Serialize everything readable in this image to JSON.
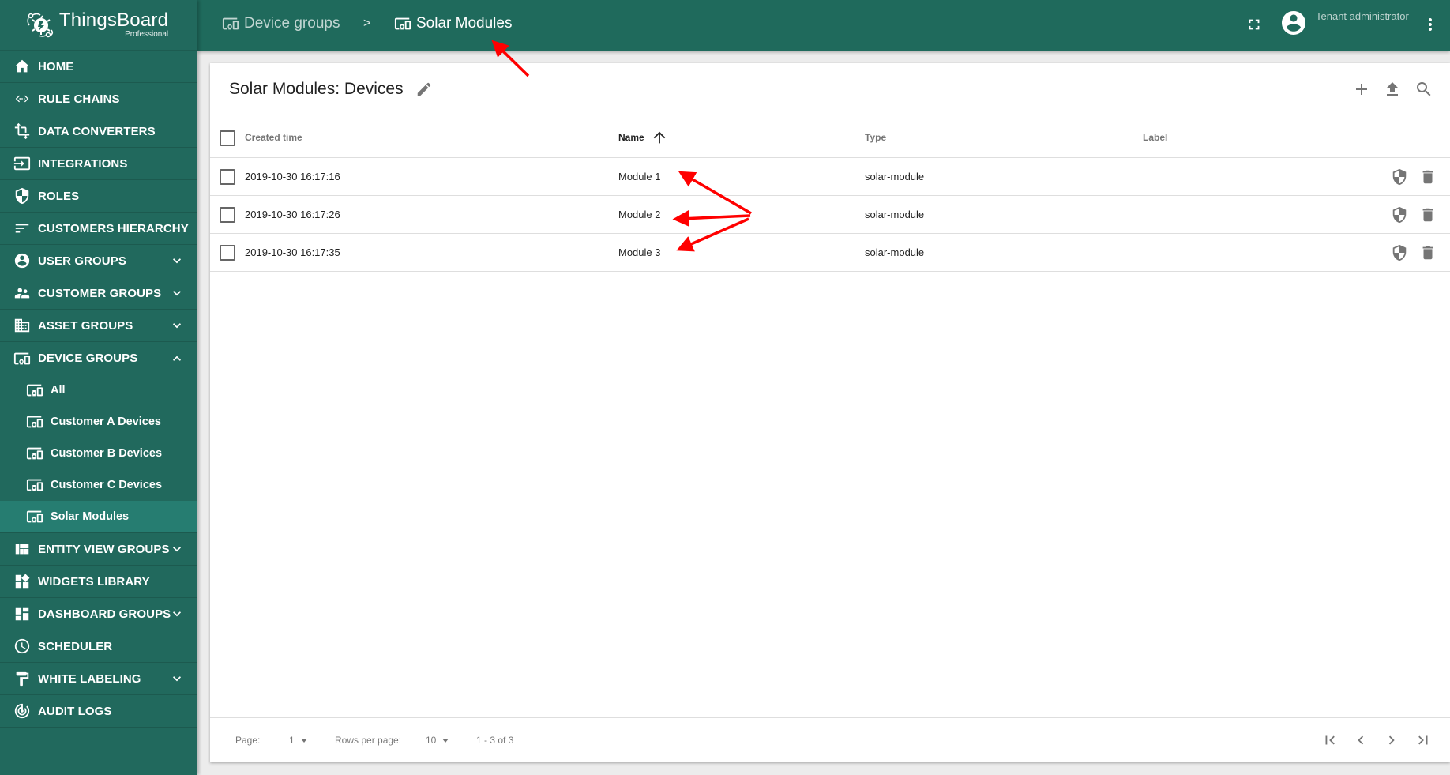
{
  "app": {
    "brand": "ThingsBoard",
    "edition": "Professional"
  },
  "sidebar": {
    "items": [
      {
        "label": "HOME",
        "icon": "home-icon"
      },
      {
        "label": "RULE CHAINS",
        "icon": "rule-chains-icon"
      },
      {
        "label": "DATA CONVERTERS",
        "icon": "transform-icon"
      },
      {
        "label": "INTEGRATIONS",
        "icon": "input-icon"
      },
      {
        "label": "ROLES",
        "icon": "shield-icon"
      },
      {
        "label": "CUSTOMERS HIERARCHY",
        "icon": "sort-icon"
      },
      {
        "label": "USER GROUPS",
        "icon": "account-circle-icon",
        "expandable": true
      },
      {
        "label": "CUSTOMER GROUPS",
        "icon": "supervisor-icon",
        "expandable": true
      },
      {
        "label": "ASSET GROUPS",
        "icon": "domain-icon",
        "expandable": true
      },
      {
        "label": "DEVICE GROUPS",
        "icon": "devices-other-icon",
        "expandable": true,
        "expanded": true
      },
      {
        "label": "ENTITY VIEW GROUPS",
        "icon": "view-quilt-icon",
        "expandable": true
      },
      {
        "label": "WIDGETS LIBRARY",
        "icon": "widgets-icon"
      },
      {
        "label": "DASHBOARD GROUPS",
        "icon": "dashboard-icon",
        "expandable": true
      },
      {
        "label": "SCHEDULER",
        "icon": "schedule-icon"
      },
      {
        "label": "WHITE LABELING",
        "icon": "format-paint-icon",
        "expandable": true
      },
      {
        "label": "AUDIT LOGS",
        "icon": "track-changes-icon"
      }
    ],
    "device_groups": [
      {
        "label": "All",
        "active": false
      },
      {
        "label": "Customer A Devices",
        "active": false
      },
      {
        "label": "Customer B Devices",
        "active": false
      },
      {
        "label": "Customer C Devices",
        "active": false
      },
      {
        "label": "Solar Modules",
        "active": true
      }
    ]
  },
  "topbar": {
    "breadcrumb": [
      {
        "label": "Device groups"
      },
      {
        "label": "Solar Modules"
      }
    ],
    "separator": ">",
    "user_role": "Tenant administrator"
  },
  "card": {
    "title": "Solar Modules: Devices"
  },
  "table": {
    "columns": [
      {
        "label": "Created time"
      },
      {
        "label": "Name",
        "sorted": "asc"
      },
      {
        "label": "Type"
      },
      {
        "label": "Label"
      }
    ],
    "rows": [
      {
        "created": "2019-10-30 16:17:16",
        "name": "Module 1",
        "type": "solar-module",
        "label": ""
      },
      {
        "created": "2019-10-30 16:17:26",
        "name": "Module 2",
        "type": "solar-module",
        "label": ""
      },
      {
        "created": "2019-10-30 16:17:35",
        "name": "Module 3",
        "type": "solar-module",
        "label": ""
      }
    ]
  },
  "paginator": {
    "page_label": "Page:",
    "page_value": "1",
    "rows_label": "Rows per page:",
    "rows_value": "10",
    "range": "1 - 3 of 3"
  },
  "colors": {
    "primary": "#1f6a5c",
    "sidebar": "#21695d",
    "active": "#267d71",
    "annotation": "#ff0000"
  }
}
